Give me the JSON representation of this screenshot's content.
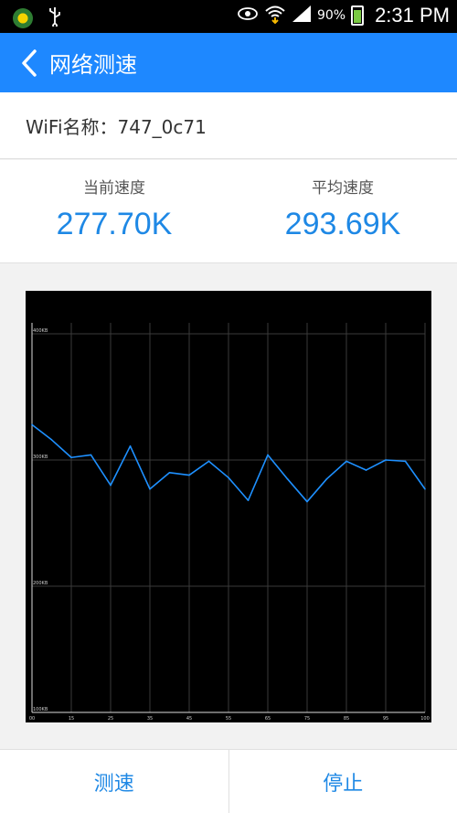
{
  "status": {
    "battery": "90%",
    "time": "2:31 PM",
    "battery_color": "#7ac943"
  },
  "header": {
    "title": "网络测速",
    "bg_color": "#1e88ff"
  },
  "wifi": {
    "label": "WiFi名称：747_0c71"
  },
  "stats": {
    "current_label": "当前速度",
    "current_value": "277.70K",
    "average_label": "平均速度",
    "average_value": "293.69K",
    "value_color": "#1e88e5"
  },
  "chart_data": {
    "type": "line",
    "x": [
      0,
      5,
      10,
      15,
      20,
      25,
      30,
      35,
      40,
      45,
      50,
      55,
      60,
      65,
      70,
      75,
      80,
      85,
      90,
      95,
      100
    ],
    "x_tick_labels": [
      "00",
      "15",
      "25",
      "35",
      "45",
      "55",
      "65",
      "75",
      "85",
      "95",
      "100"
    ],
    "x_ticks": [
      0,
      10,
      20,
      30,
      40,
      50,
      60,
      70,
      80,
      90,
      100
    ],
    "series": [
      {
        "values": [
          328,
          316,
          302,
          304,
          280,
          311,
          277,
          290,
          288,
          299,
          286,
          268,
          304,
          285,
          267,
          285,
          299,
          292,
          300,
          299,
          277
        ]
      }
    ],
    "y_tick_labels": [
      "400KB",
      "300KB",
      "200KB",
      "100KB"
    ],
    "y_ticks": [
      400,
      300,
      200,
      100
    ],
    "xlim": [
      0,
      100
    ],
    "ylim": [
      100,
      400
    ],
    "grid": true,
    "line_color": "#1e90ff",
    "bg_color": "#000000"
  },
  "actions": {
    "test_label": "测速",
    "stop_label": "停止"
  }
}
